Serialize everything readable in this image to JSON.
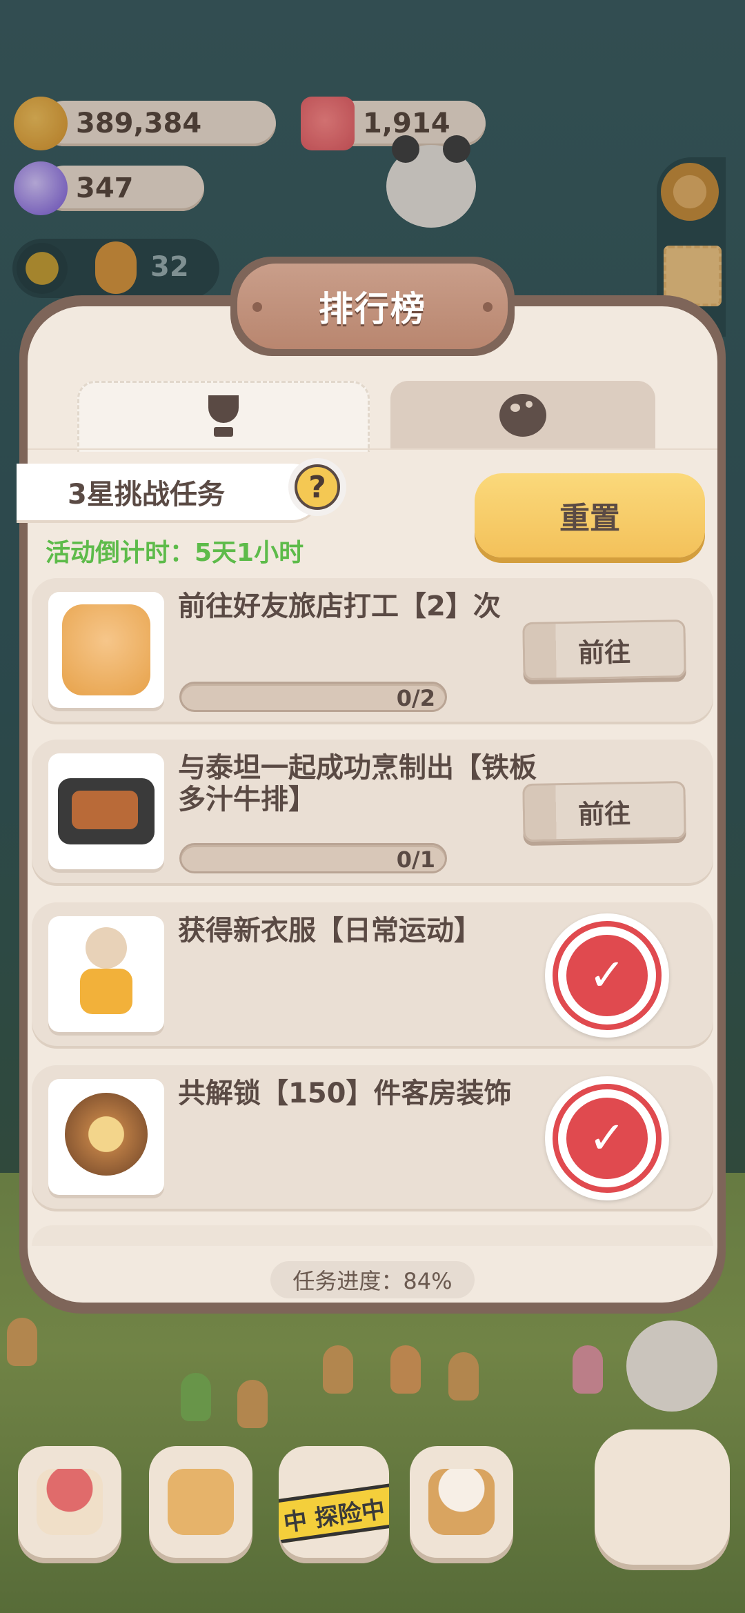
{
  "resources": {
    "cookies": "389,384",
    "candles": "1,914",
    "candies": "347",
    "helper_count": "32"
  },
  "panel": {
    "title": "排行榜",
    "tabs": [
      {
        "icon": "trophy-icon",
        "active": true
      },
      {
        "icon": "planet-icon",
        "active": false
      }
    ],
    "challenge_label": "3星挑战任务",
    "help_symbol": "?",
    "countdown": "活动倒计时：5天1小时",
    "reset_label": "重置",
    "tasks": [
      {
        "title": "前往好友旅店打工【2】次",
        "progress": "0/2",
        "action": "前往",
        "done": false
      },
      {
        "title": "与泰坦一起成功烹制出【铁板多汁牛排】",
        "progress": "0/1",
        "action": "前往",
        "done": false
      },
      {
        "title": "获得新衣服【日常运动】",
        "done": true
      },
      {
        "title": "共解锁【150】件客房装饰",
        "done": true
      }
    ],
    "overall_progress": "任务进度：84%"
  },
  "bottom_nav": {
    "explore_label": "中 探险中"
  },
  "colors": {
    "accent_green": "#5dbb4a",
    "reset_yellow": "#f3c15a",
    "stamp_red": "#e04a4f",
    "panel_brown": "#7e6559"
  }
}
